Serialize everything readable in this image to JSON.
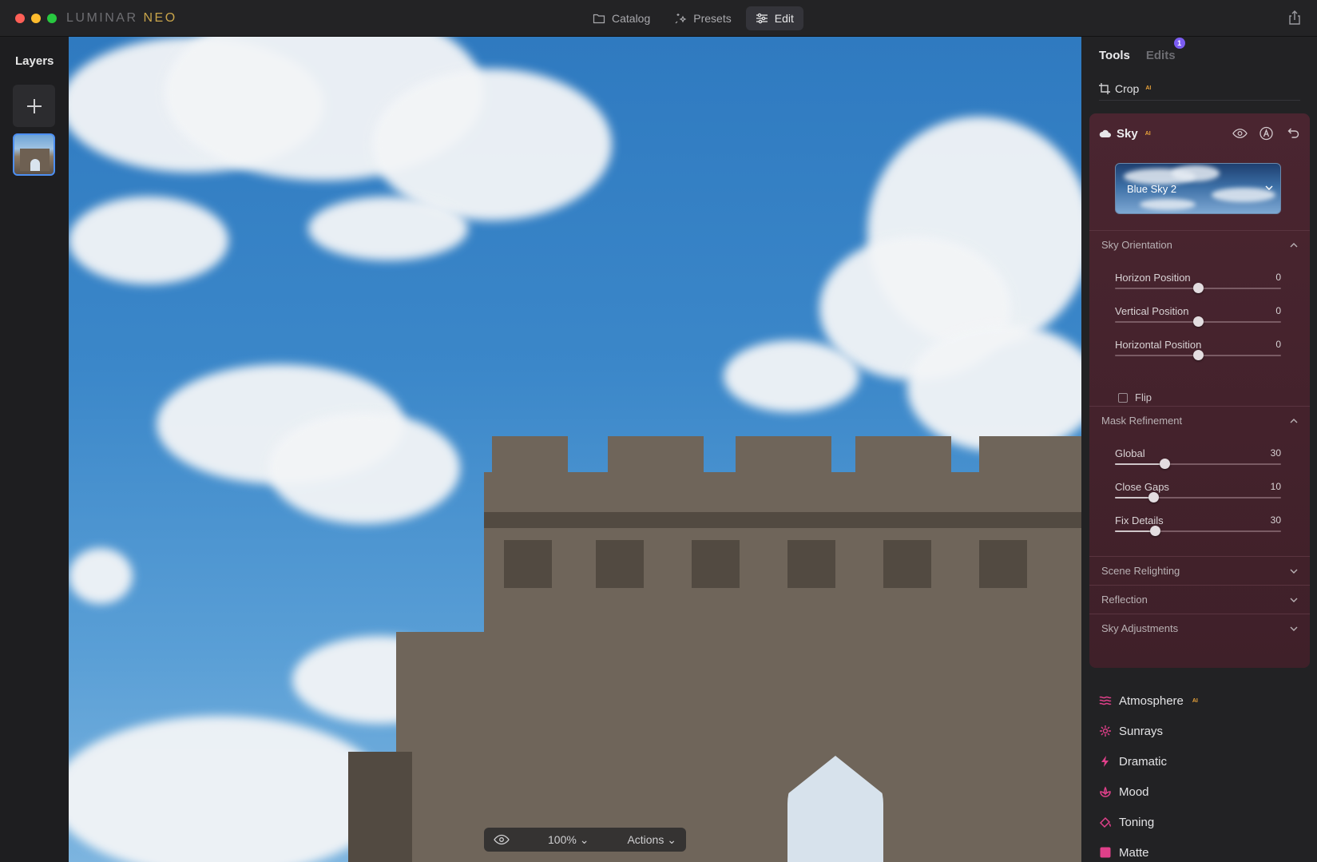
{
  "app": {
    "logo_part1": "LUMINAR",
    "logo_part2": "NEO"
  },
  "topnav": {
    "items": [
      {
        "label": "Catalog",
        "icon": "folder-icon"
      },
      {
        "label": "Presets",
        "icon": "sparkle-icon"
      },
      {
        "label": "Edit",
        "icon": "sliders-icon",
        "active": true
      }
    ]
  },
  "layers": {
    "title": "Layers"
  },
  "canvas_bar": {
    "zoom": "100%",
    "actions": "Actions"
  },
  "panel": {
    "tabs": {
      "tools": "Tools",
      "edits": "Edits",
      "edits_badge": "1"
    },
    "crop": {
      "label": "Crop",
      "ai": "AI"
    },
    "sky": {
      "title": "Sky",
      "ai": "AI",
      "preset": "Blue Sky 2",
      "sections": {
        "orientation": "Sky Orientation",
        "mask": "Mask Refinement",
        "relighting": "Scene Relighting",
        "reflection": "Reflection",
        "adjustments": "Sky Adjustments"
      },
      "orientation_sliders": [
        {
          "name": "Horizon Position",
          "value": "0",
          "fraction": 0.5
        },
        {
          "name": "Vertical Position",
          "value": "0",
          "fraction": 0.5
        },
        {
          "name": "Horizontal Position",
          "value": "0",
          "fraction": 0.5
        }
      ],
      "flip_label": "Flip",
      "mask_sliders": [
        {
          "name": "Global",
          "value": "30",
          "fraction": 0.3
        },
        {
          "name": "Close Gaps",
          "value": "10",
          "fraction": 0.23
        },
        {
          "name": "Fix Details",
          "value": "30",
          "fraction": 0.24
        }
      ]
    },
    "tools": [
      {
        "label": "Atmosphere",
        "ai": "AI",
        "icon": "atmosphere-icon",
        "color": "#e0408a"
      },
      {
        "label": "Sunrays",
        "icon": "sunrays-icon",
        "color": "#e0408a"
      },
      {
        "label": "Dramatic",
        "icon": "dramatic-icon",
        "color": "#e0408a"
      },
      {
        "label": "Mood",
        "icon": "mood-icon",
        "color": "#e0408a"
      },
      {
        "label": "Toning",
        "icon": "toning-icon",
        "color": "#e0408a"
      },
      {
        "label": "Matte",
        "icon": "matte-icon",
        "color": "#e0408a"
      }
    ]
  },
  "colors": {
    "accent": "#e0408a",
    "selection": "#4d8ff2",
    "badge": "#7b5cf2",
    "ai_tag": "#e8a23a",
    "sky_card": "#4a2530"
  }
}
